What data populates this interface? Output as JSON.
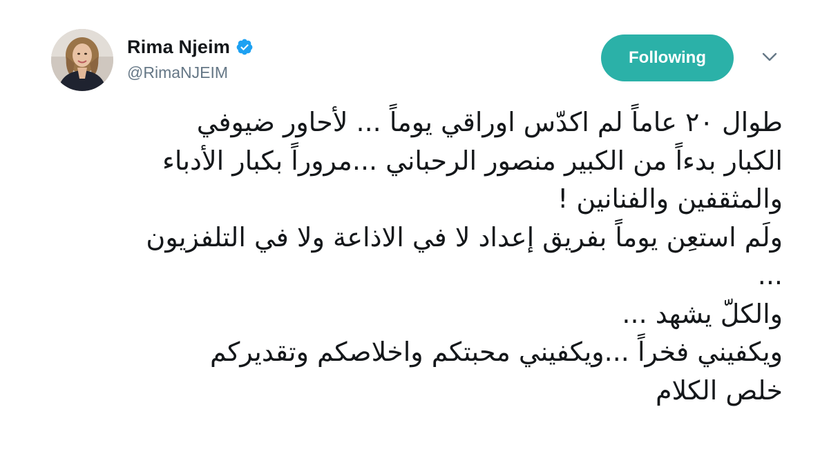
{
  "tweet": {
    "author": {
      "display_name": "Rima Njeim",
      "handle": "@RimaNJEIM",
      "verified": true
    },
    "follow_button_label": "Following",
    "lines": [
      "طوال ٢٠ عاماً لم  اكدّس اوراقي يوماً ... لأحاور ضيوفي",
      "الكبار  بدءاً من الكبير منصور الرحباني ...مروراً بكبار الأدباء",
      "والمثقفين والفنانين !",
      "ولَم استعِن يوماً بفريق إعداد لا في  الاذاعة ولا في التلفزيون",
      "...",
      "والكلّ يشهد ...",
      "ويكفيني فخراً ...ويكفيني محبتكم واخلاصكم وتقديركم",
      "خلص الكلام"
    ]
  },
  "colors": {
    "follow_button_bg": "#2bb1a8",
    "verified_badge": "#1da1f2",
    "handle_text": "#657786",
    "caret": "#657786"
  },
  "icons": {
    "verified": "verified-badge-icon",
    "caret": "chevron-down-icon",
    "avatar": "profile-avatar"
  }
}
